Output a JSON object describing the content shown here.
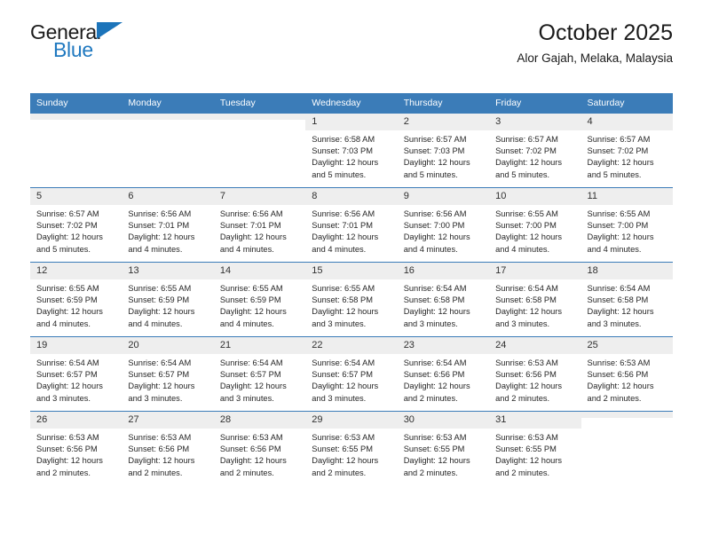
{
  "brand": {
    "name_top": "General",
    "name_bottom": "Blue",
    "accent_color": "#1c74ba",
    "header_color": "#3b7cb8"
  },
  "header": {
    "title": "October 2025",
    "subtitle": "Alor Gajah, Melaka, Malaysia"
  },
  "weekdays": [
    "Sunday",
    "Monday",
    "Tuesday",
    "Wednesday",
    "Thursday",
    "Friday",
    "Saturday"
  ],
  "weeks": [
    [
      {
        "empty": true,
        "day": ""
      },
      {
        "empty": true,
        "day": ""
      },
      {
        "empty": true,
        "day": ""
      },
      {
        "empty": false,
        "day": "1",
        "sunrise": "Sunrise: 6:58 AM",
        "sunset": "Sunset: 7:03 PM",
        "daylight_line1": "Daylight: 12 hours",
        "daylight_line2": "and 5 minutes."
      },
      {
        "empty": false,
        "day": "2",
        "sunrise": "Sunrise: 6:57 AM",
        "sunset": "Sunset: 7:03 PM",
        "daylight_line1": "Daylight: 12 hours",
        "daylight_line2": "and 5 minutes."
      },
      {
        "empty": false,
        "day": "3",
        "sunrise": "Sunrise: 6:57 AM",
        "sunset": "Sunset: 7:02 PM",
        "daylight_line1": "Daylight: 12 hours",
        "daylight_line2": "and 5 minutes."
      },
      {
        "empty": false,
        "day": "4",
        "sunrise": "Sunrise: 6:57 AM",
        "sunset": "Sunset: 7:02 PM",
        "daylight_line1": "Daylight: 12 hours",
        "daylight_line2": "and 5 minutes."
      }
    ],
    [
      {
        "empty": false,
        "day": "5",
        "sunrise": "Sunrise: 6:57 AM",
        "sunset": "Sunset: 7:02 PM",
        "daylight_line1": "Daylight: 12 hours",
        "daylight_line2": "and 5 minutes."
      },
      {
        "empty": false,
        "day": "6",
        "sunrise": "Sunrise: 6:56 AM",
        "sunset": "Sunset: 7:01 PM",
        "daylight_line1": "Daylight: 12 hours",
        "daylight_line2": "and 4 minutes."
      },
      {
        "empty": false,
        "day": "7",
        "sunrise": "Sunrise: 6:56 AM",
        "sunset": "Sunset: 7:01 PM",
        "daylight_line1": "Daylight: 12 hours",
        "daylight_line2": "and 4 minutes."
      },
      {
        "empty": false,
        "day": "8",
        "sunrise": "Sunrise: 6:56 AM",
        "sunset": "Sunset: 7:01 PM",
        "daylight_line1": "Daylight: 12 hours",
        "daylight_line2": "and 4 minutes."
      },
      {
        "empty": false,
        "day": "9",
        "sunrise": "Sunrise: 6:56 AM",
        "sunset": "Sunset: 7:00 PM",
        "daylight_line1": "Daylight: 12 hours",
        "daylight_line2": "and 4 minutes."
      },
      {
        "empty": false,
        "day": "10",
        "sunrise": "Sunrise: 6:55 AM",
        "sunset": "Sunset: 7:00 PM",
        "daylight_line1": "Daylight: 12 hours",
        "daylight_line2": "and 4 minutes."
      },
      {
        "empty": false,
        "day": "11",
        "sunrise": "Sunrise: 6:55 AM",
        "sunset": "Sunset: 7:00 PM",
        "daylight_line1": "Daylight: 12 hours",
        "daylight_line2": "and 4 minutes."
      }
    ],
    [
      {
        "empty": false,
        "day": "12",
        "sunrise": "Sunrise: 6:55 AM",
        "sunset": "Sunset: 6:59 PM",
        "daylight_line1": "Daylight: 12 hours",
        "daylight_line2": "and 4 minutes."
      },
      {
        "empty": false,
        "day": "13",
        "sunrise": "Sunrise: 6:55 AM",
        "sunset": "Sunset: 6:59 PM",
        "daylight_line1": "Daylight: 12 hours",
        "daylight_line2": "and 4 minutes."
      },
      {
        "empty": false,
        "day": "14",
        "sunrise": "Sunrise: 6:55 AM",
        "sunset": "Sunset: 6:59 PM",
        "daylight_line1": "Daylight: 12 hours",
        "daylight_line2": "and 4 minutes."
      },
      {
        "empty": false,
        "day": "15",
        "sunrise": "Sunrise: 6:55 AM",
        "sunset": "Sunset: 6:58 PM",
        "daylight_line1": "Daylight: 12 hours",
        "daylight_line2": "and 3 minutes."
      },
      {
        "empty": false,
        "day": "16",
        "sunrise": "Sunrise: 6:54 AM",
        "sunset": "Sunset: 6:58 PM",
        "daylight_line1": "Daylight: 12 hours",
        "daylight_line2": "and 3 minutes."
      },
      {
        "empty": false,
        "day": "17",
        "sunrise": "Sunrise: 6:54 AM",
        "sunset": "Sunset: 6:58 PM",
        "daylight_line1": "Daylight: 12 hours",
        "daylight_line2": "and 3 minutes."
      },
      {
        "empty": false,
        "day": "18",
        "sunrise": "Sunrise: 6:54 AM",
        "sunset": "Sunset: 6:58 PM",
        "daylight_line1": "Daylight: 12 hours",
        "daylight_line2": "and 3 minutes."
      }
    ],
    [
      {
        "empty": false,
        "day": "19",
        "sunrise": "Sunrise: 6:54 AM",
        "sunset": "Sunset: 6:57 PM",
        "daylight_line1": "Daylight: 12 hours",
        "daylight_line2": "and 3 minutes."
      },
      {
        "empty": false,
        "day": "20",
        "sunrise": "Sunrise: 6:54 AM",
        "sunset": "Sunset: 6:57 PM",
        "daylight_line1": "Daylight: 12 hours",
        "daylight_line2": "and 3 minutes."
      },
      {
        "empty": false,
        "day": "21",
        "sunrise": "Sunrise: 6:54 AM",
        "sunset": "Sunset: 6:57 PM",
        "daylight_line1": "Daylight: 12 hours",
        "daylight_line2": "and 3 minutes."
      },
      {
        "empty": false,
        "day": "22",
        "sunrise": "Sunrise: 6:54 AM",
        "sunset": "Sunset: 6:57 PM",
        "daylight_line1": "Daylight: 12 hours",
        "daylight_line2": "and 3 minutes."
      },
      {
        "empty": false,
        "day": "23",
        "sunrise": "Sunrise: 6:54 AM",
        "sunset": "Sunset: 6:56 PM",
        "daylight_line1": "Daylight: 12 hours",
        "daylight_line2": "and 2 minutes."
      },
      {
        "empty": false,
        "day": "24",
        "sunrise": "Sunrise: 6:53 AM",
        "sunset": "Sunset: 6:56 PM",
        "daylight_line1": "Daylight: 12 hours",
        "daylight_line2": "and 2 minutes."
      },
      {
        "empty": false,
        "day": "25",
        "sunrise": "Sunrise: 6:53 AM",
        "sunset": "Sunset: 6:56 PM",
        "daylight_line1": "Daylight: 12 hours",
        "daylight_line2": "and 2 minutes."
      }
    ],
    [
      {
        "empty": false,
        "day": "26",
        "sunrise": "Sunrise: 6:53 AM",
        "sunset": "Sunset: 6:56 PM",
        "daylight_line1": "Daylight: 12 hours",
        "daylight_line2": "and 2 minutes."
      },
      {
        "empty": false,
        "day": "27",
        "sunrise": "Sunrise: 6:53 AM",
        "sunset": "Sunset: 6:56 PM",
        "daylight_line1": "Daylight: 12 hours",
        "daylight_line2": "and 2 minutes."
      },
      {
        "empty": false,
        "day": "28",
        "sunrise": "Sunrise: 6:53 AM",
        "sunset": "Sunset: 6:56 PM",
        "daylight_line1": "Daylight: 12 hours",
        "daylight_line2": "and 2 minutes."
      },
      {
        "empty": false,
        "day": "29",
        "sunrise": "Sunrise: 6:53 AM",
        "sunset": "Sunset: 6:55 PM",
        "daylight_line1": "Daylight: 12 hours",
        "daylight_line2": "and 2 minutes."
      },
      {
        "empty": false,
        "day": "30",
        "sunrise": "Sunrise: 6:53 AM",
        "sunset": "Sunset: 6:55 PM",
        "daylight_line1": "Daylight: 12 hours",
        "daylight_line2": "and 2 minutes."
      },
      {
        "empty": false,
        "day": "31",
        "sunrise": "Sunrise: 6:53 AM",
        "sunset": "Sunset: 6:55 PM",
        "daylight_line1": "Daylight: 12 hours",
        "daylight_line2": "and 2 minutes."
      },
      {
        "empty": true,
        "day": ""
      }
    ]
  ]
}
